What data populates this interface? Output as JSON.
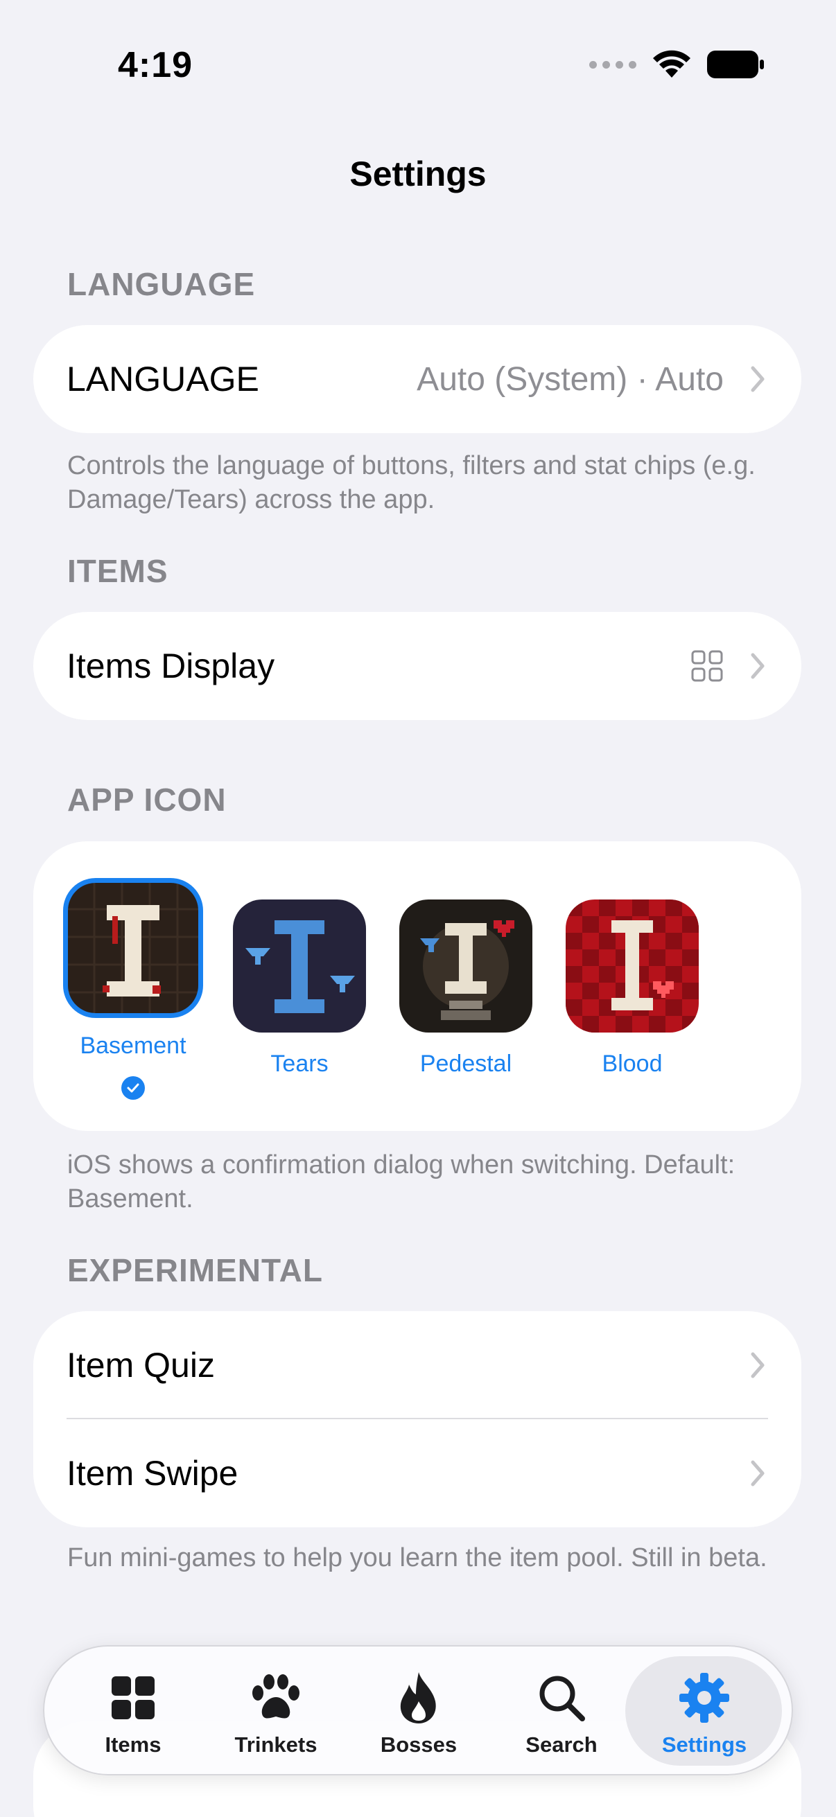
{
  "status": {
    "time": "4:19"
  },
  "nav": {
    "title": "Settings"
  },
  "language_section": {
    "header": "LANGUAGE",
    "row_label": "LANGUAGE",
    "row_value": "Auto (System) · Auto",
    "footer": "Controls the language of buttons, filters and stat chips (e.g. Damage/Tears) across the app."
  },
  "items_section": {
    "header": "ITEMS",
    "row_label": "Items Display",
    "row_icon": "grid-icon"
  },
  "app_icon_section": {
    "header": "APP ICON",
    "options": [
      {
        "label": "Basement",
        "selected": true,
        "color": "#2b2019"
      },
      {
        "label": "Tears",
        "selected": false,
        "color": "#25233a"
      },
      {
        "label": "Pedestal",
        "selected": false,
        "color": "#201c18"
      },
      {
        "label": "Blood",
        "selected": false,
        "color": "#b5121b"
      }
    ],
    "footer": "iOS shows a confirmation dialog when switching. Default: Basement."
  },
  "experimental_section": {
    "header": "EXPERIMENTAL",
    "rows": [
      {
        "label": "Item Quiz"
      },
      {
        "label": "Item Swipe"
      }
    ],
    "footer": "Fun mini-games to help you learn the item pool. Still in beta."
  },
  "tabbar": {
    "tabs": [
      {
        "label": "Items",
        "icon": "grid-icon"
      },
      {
        "label": "Trinkets",
        "icon": "paw-icon"
      },
      {
        "label": "Bosses",
        "icon": "flame-icon"
      },
      {
        "label": "Search",
        "icon": "search-icon"
      },
      {
        "label": "Settings",
        "icon": "gear-icon",
        "active": true
      }
    ]
  },
  "colors": {
    "accent": "#1a82f0",
    "background": "#f2f2f7",
    "secondary_text": "#86868b"
  }
}
